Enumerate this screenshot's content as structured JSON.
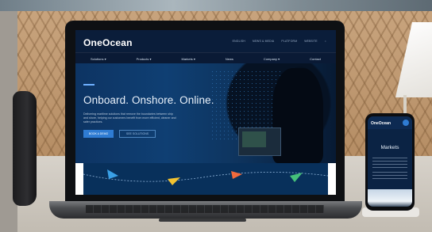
{
  "site": {
    "logo": "OneOcean",
    "utility_nav": [
      "ENGLISH",
      "NEWS & MEDIA",
      "PLATFORM",
      "WEBSITE"
    ],
    "main_nav": [
      "Solutions ▾",
      "Products ▾",
      "Markets ▾",
      "News",
      "Company ▾",
      "Contact"
    ],
    "hero": {
      "title": "Onboard. Onshore. Online.",
      "description": "Delivering maritime solutions that remove the boundaries between ship and shore, helping our customers benefit from more efficient, cleaner and safer practices.",
      "primary_button": "BOOK A DEMO",
      "secondary_button": "SEE SOLUTIONS"
    }
  },
  "phone": {
    "logo": "OneOcean",
    "title": "Markets"
  },
  "icons": {
    "arrow_colors": [
      "#3aa0e6",
      "#f2c230",
      "#f06a3c",
      "#45c07a"
    ]
  }
}
